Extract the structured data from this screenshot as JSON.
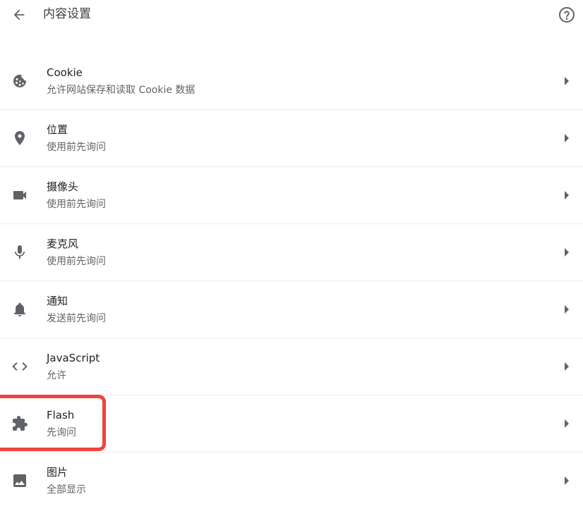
{
  "header": {
    "title": "内容设置",
    "back_icon": "arrow-left-icon",
    "help_icon": "help-circle-icon"
  },
  "colors": {
    "icon": "#5f6368",
    "highlight": "#f0433f"
  },
  "settings": [
    {
      "icon": "cookie-icon",
      "title": "Cookie",
      "subtitle": "允许网站保存和读取 Cookie 数据"
    },
    {
      "icon": "location-pin-icon",
      "title": "位置",
      "subtitle": "使用前先询问"
    },
    {
      "icon": "camera-icon",
      "title": "摄像头",
      "subtitle": "使用前先询问"
    },
    {
      "icon": "microphone-icon",
      "title": "麦克风",
      "subtitle": "使用前先询问"
    },
    {
      "icon": "bell-icon",
      "title": "通知",
      "subtitle": "发送前先询问"
    },
    {
      "icon": "code-icon",
      "title": "JavaScript",
      "subtitle": "允许"
    },
    {
      "icon": "puzzle-icon",
      "title": "Flash",
      "subtitle": "先询问"
    },
    {
      "icon": "image-icon",
      "title": "图片",
      "subtitle": "全部显示"
    }
  ]
}
